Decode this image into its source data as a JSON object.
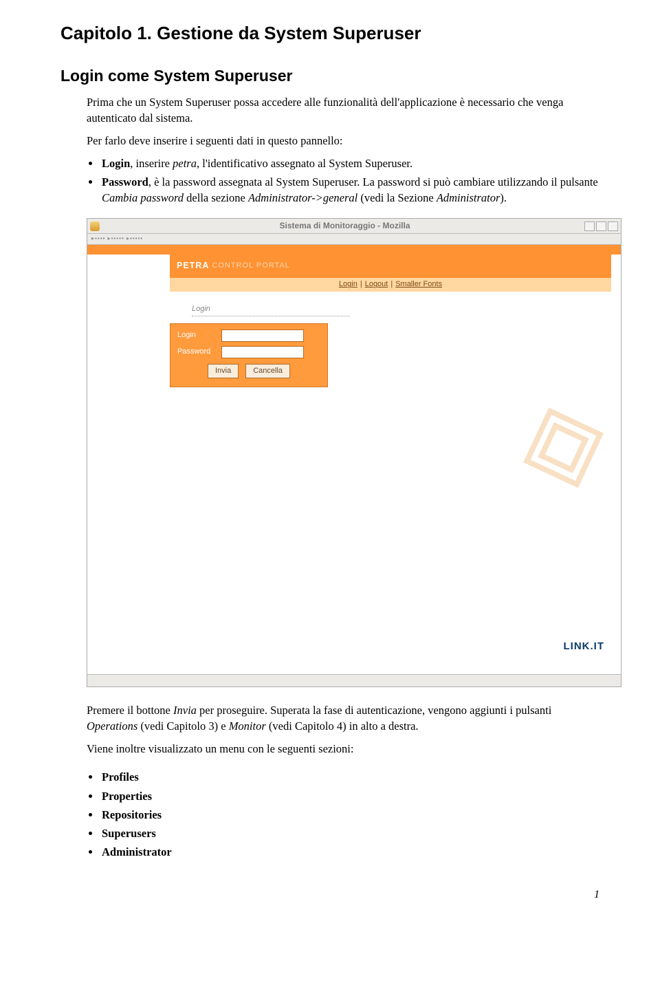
{
  "chapter_title": "Capitolo 1. Gestione da System Superuser",
  "section_title": "Login come System Superuser",
  "intro_para": "Prima che un System Superuser possa accedere alle funzionalità dell'applicazione è necessario che venga autenticato dal sistema.",
  "intro_para2": "Per farlo deve inserire i seguenti dati in questo pannello:",
  "bullets_login": {
    "item1_bold": "Login",
    "item1_text1": ", inserire ",
    "item1_ital": "petra",
    "item1_text2": ", l'identificativo assegnato al System Superuser.",
    "item2_bold": "Password",
    "item2_text1": ", è la password assegnata al System Superuser. La password si può cambiare utilizzando il pulsante ",
    "item2_ital": "Cambia password",
    "item2_text2": " della sezione ",
    "item2_ital2": "Administrator->general",
    "item2_text3": " (vedi la Sezione ",
    "item2_ital3": "Administrator",
    "item2_text4": ")."
  },
  "mozilla": {
    "title": "Sistema di Monitoraggio - Mozilla",
    "brand": "PETRA",
    "brand_sub": "CONTROL PORTAL",
    "link_login": "Login",
    "link_logout": "Logout",
    "link_fonts": "Smaller Fonts",
    "crumb": "Login",
    "field_login": "Login",
    "field_password": "Password",
    "btn_invia": "Invia",
    "btn_cancella": "Cancella",
    "linkit": "LINK.IT"
  },
  "after_para1_pre": "Premere il bottone ",
  "after_para1_ital1": "Invia",
  "after_para1_mid1": " per proseguire. Superata la fase di autenticazione, vengono aggiunti i pulsanti ",
  "after_para1_ital2": "Operations",
  "after_para1_mid2": " (vedi Capitolo 3) e ",
  "after_para1_ital3": "Monitor",
  "after_para1_mid3": " (vedi Capitolo 4) in alto a destra.",
  "after_para2": "Viene inoltre visualizzato un menu con le seguenti sezioni:",
  "menu_items": [
    "Profiles",
    "Properties",
    "Repositories",
    "Superusers",
    "Administrator"
  ],
  "page_number": "1"
}
